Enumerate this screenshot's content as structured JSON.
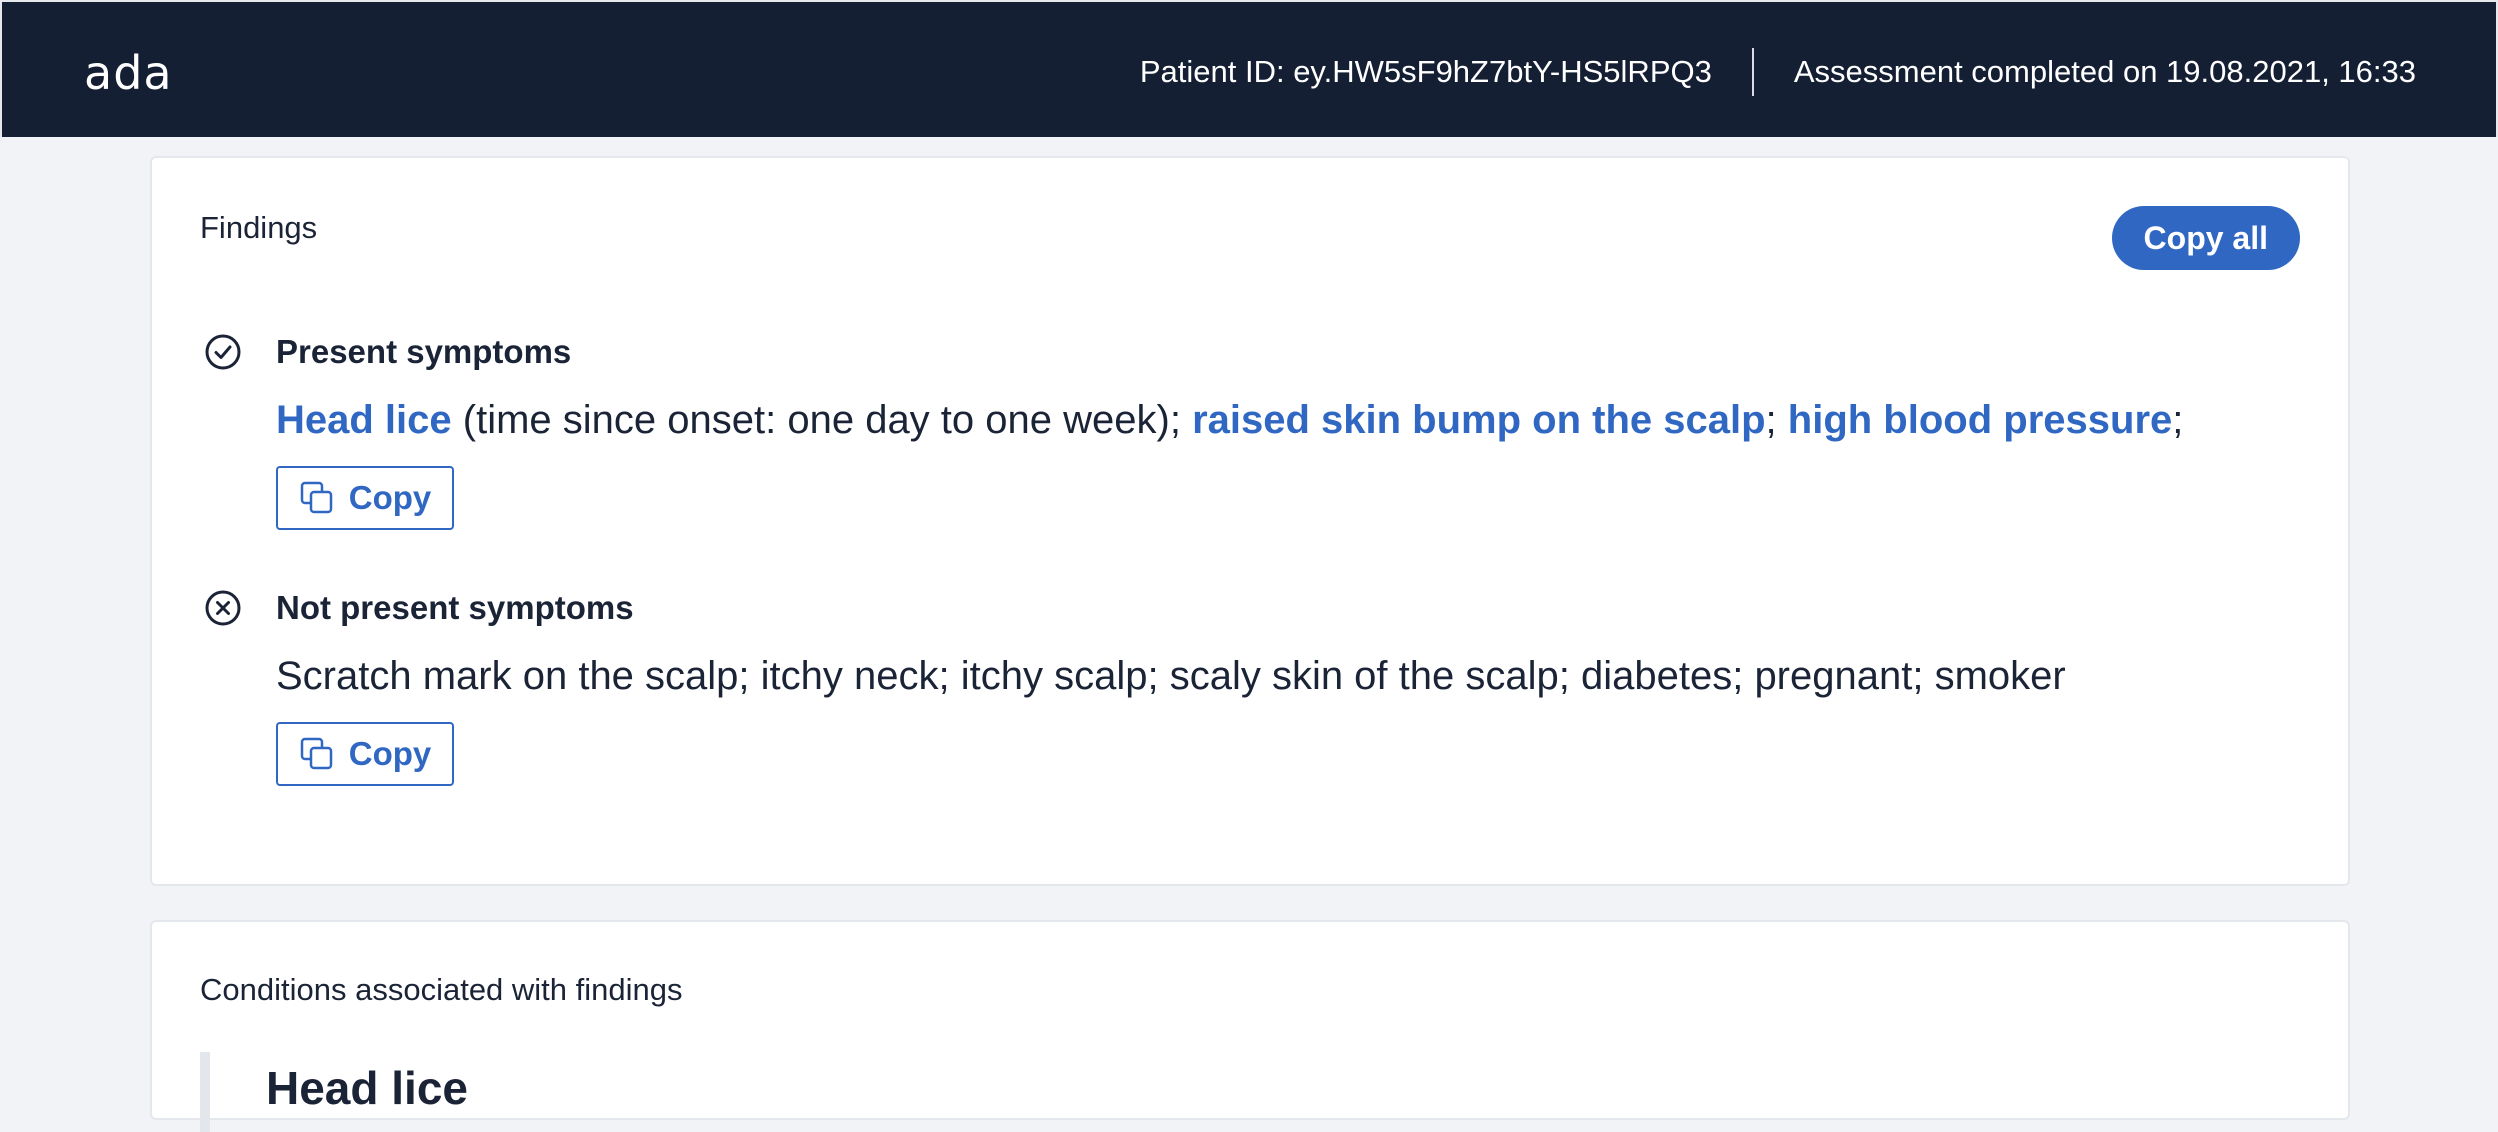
{
  "header": {
    "logo": "ada",
    "patient_id": "Patient ID: ey.HW5sF9hZ7btY-HS5lRPQ3",
    "assessment": "Assessment completed on 19.08.2021, 16:33"
  },
  "findings": {
    "title": "Findings",
    "copy_all_label": "Copy all",
    "present": {
      "title": "Present symptoms",
      "items": [
        {
          "name": "Head lice",
          "detail": " (time since onset: one day to one week)",
          "sep": "; "
        },
        {
          "name": "raised skin bump on the scalp",
          "detail": "",
          "sep": "; "
        },
        {
          "name": "high blood pressure",
          "detail": "",
          "sep": ";"
        }
      ],
      "copy_label": "Copy"
    },
    "absent": {
      "title": "Not present symptoms",
      "text": "Scratch mark on the scalp; itchy neck; itchy scalp; scaly skin of the scalp; diabetes; pregnant; smoker",
      "copy_label": "Copy"
    }
  },
  "conditions": {
    "title": "Conditions associated with findings",
    "items": [
      {
        "name": "Head lice"
      }
    ]
  },
  "colors": {
    "header_bg": "#141f33",
    "accent": "#2f67c3",
    "page_bg": "#f1f3f6",
    "text": "#1b2437"
  }
}
